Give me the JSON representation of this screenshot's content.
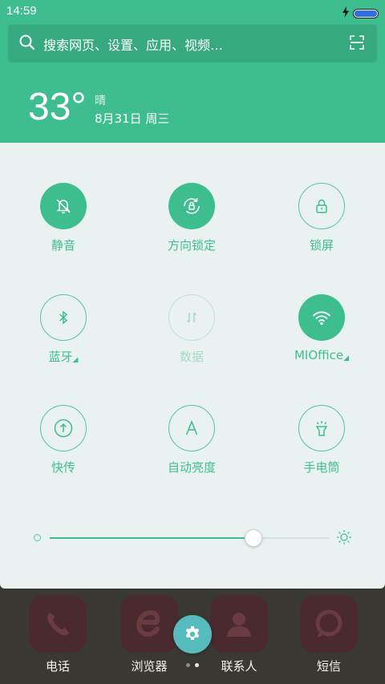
{
  "status": {
    "time": "14:59",
    "battery_level": 1.0
  },
  "search": {
    "placeholder": "搜索网页、设置、应用、视频…"
  },
  "weather": {
    "temp": "33°",
    "condition": "晴",
    "date": "8月31日  周三"
  },
  "toggles": [
    {
      "label": "静音",
      "icon": "bell-off-icon",
      "state": "on"
    },
    {
      "label": "方向锁定",
      "icon": "rotation-lock-icon",
      "state": "on"
    },
    {
      "label": "锁屏",
      "icon": "lock-icon",
      "state": "off"
    },
    {
      "label": "蓝牙",
      "icon": "bluetooth-icon",
      "state": "off",
      "has_menu": true
    },
    {
      "label": "数据",
      "icon": "mobile-data-icon",
      "state": "disabled"
    },
    {
      "label": "MIOffice",
      "icon": "wifi-icon",
      "state": "on",
      "has_menu": true
    },
    {
      "label": "快传",
      "icon": "transfer-icon",
      "state": "off"
    },
    {
      "label": "自动亮度",
      "icon": "auto-brightness-icon",
      "state": "off"
    },
    {
      "label": "手电筒",
      "icon": "flashlight-icon",
      "state": "off"
    }
  ],
  "brightness": {
    "level": 0.73
  },
  "dock": [
    {
      "label": "电话",
      "icon": "phone-icon"
    },
    {
      "label": "浏览器",
      "icon": "browser-icon"
    },
    {
      "label": "联系人",
      "icon": "contacts-icon"
    },
    {
      "label": "短信",
      "icon": "messages-icon"
    }
  ],
  "pager": {
    "pages": 2,
    "current": 2
  },
  "colors": {
    "accent": "#3ebe8f",
    "panel_bg": "#e9f2f1",
    "gear_button": "#57bcbd"
  }
}
